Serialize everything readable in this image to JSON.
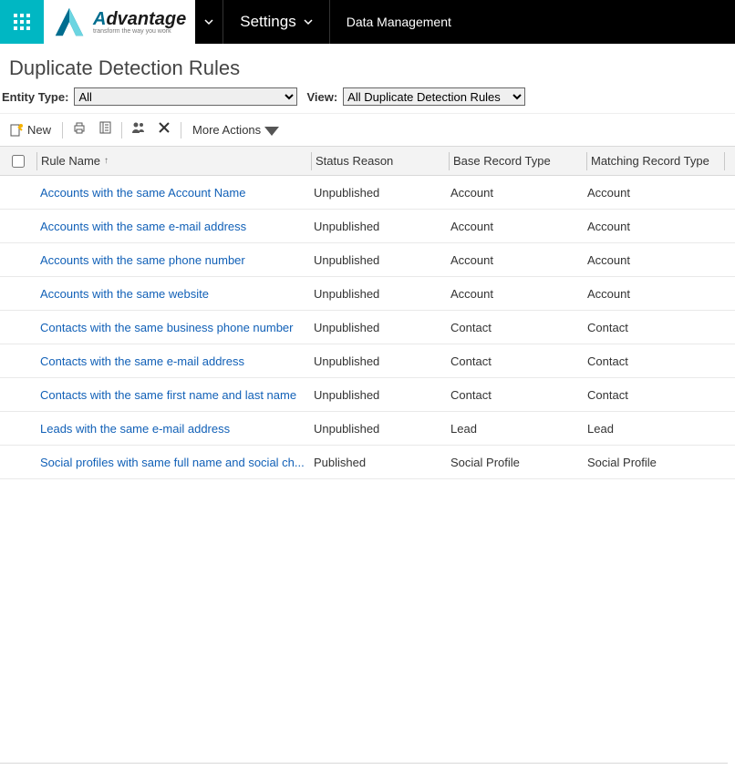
{
  "nav": {
    "settings_label": "Settings",
    "breadcrumb_label": "Data Management",
    "brand_main_first": "A",
    "brand_main_rest": "dvantage",
    "brand_sub": "transform the way you work"
  },
  "page_title": "Duplicate Detection Rules",
  "filters": {
    "entity_label": "Entity Type:",
    "entity_value": "All",
    "view_label": "View:",
    "view_value": "All Duplicate Detection Rules"
  },
  "toolbar": {
    "new_label": "New",
    "more_label": "More Actions"
  },
  "columns": {
    "rule": "Rule Name",
    "status": "Status Reason",
    "base": "Base Record Type",
    "match": "Matching Record Type"
  },
  "rows": [
    {
      "rule": "Accounts with the same Account Name",
      "status": "Unpublished",
      "base": "Account",
      "match": "Account"
    },
    {
      "rule": "Accounts with the same e-mail address",
      "status": "Unpublished",
      "base": "Account",
      "match": "Account"
    },
    {
      "rule": "Accounts with the same phone number",
      "status": "Unpublished",
      "base": "Account",
      "match": "Account"
    },
    {
      "rule": "Accounts with the same website",
      "status": "Unpublished",
      "base": "Account",
      "match": "Account"
    },
    {
      "rule": "Contacts with the same business phone number",
      "status": "Unpublished",
      "base": "Contact",
      "match": "Contact"
    },
    {
      "rule": "Contacts with the same e-mail address",
      "status": "Unpublished",
      "base": "Contact",
      "match": "Contact"
    },
    {
      "rule": "Contacts with the same first name and last name",
      "status": "Unpublished",
      "base": "Contact",
      "match": "Contact"
    },
    {
      "rule": "Leads with the same e-mail address",
      "status": "Unpublished",
      "base": "Lead",
      "match": "Lead"
    },
    {
      "rule": "Social profiles with same full name and social ch...",
      "status": "Published",
      "base": "Social Profile",
      "match": "Social Profile"
    }
  ]
}
